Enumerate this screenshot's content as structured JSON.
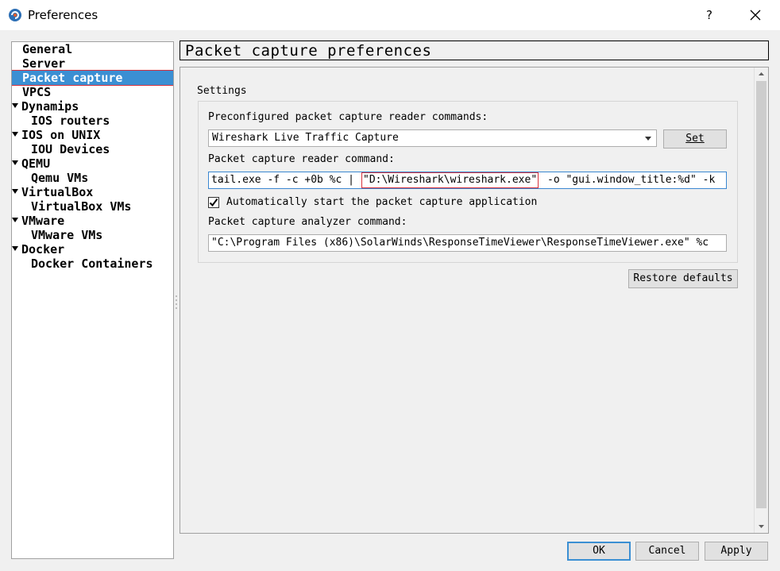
{
  "window": {
    "title": "Preferences",
    "help_label": "?"
  },
  "sidebar": {
    "items": [
      {
        "label": "General",
        "expandable": false,
        "selected": false
      },
      {
        "label": "Server",
        "expandable": false,
        "selected": false
      },
      {
        "label": "Packet capture",
        "expandable": false,
        "selected": true
      },
      {
        "label": "VPCS",
        "expandable": false,
        "selected": false
      },
      {
        "label": "Dynamips",
        "expandable": true,
        "selected": false
      },
      {
        "label": "IOS routers",
        "expandable": false,
        "selected": false
      },
      {
        "label": "IOS on UNIX",
        "expandable": true,
        "selected": false
      },
      {
        "label": "IOU Devices",
        "expandable": false,
        "selected": false
      },
      {
        "label": "QEMU",
        "expandable": true,
        "selected": false
      },
      {
        "label": "Qemu VMs",
        "expandable": false,
        "selected": false
      },
      {
        "label": "VirtualBox",
        "expandable": true,
        "selected": false
      },
      {
        "label": "VirtualBox VMs",
        "expandable": false,
        "selected": false
      },
      {
        "label": "VMware",
        "expandable": true,
        "selected": false
      },
      {
        "label": "VMware VMs",
        "expandable": false,
        "selected": false
      },
      {
        "label": "Docker",
        "expandable": true,
        "selected": false
      },
      {
        "label": "Docker Containers",
        "expandable": false,
        "selected": false
      }
    ]
  },
  "page": {
    "title": "Packet capture preferences",
    "settings_label": "Settings",
    "preconfigured_label": "Preconfigured packet capture reader commands:",
    "preconfigured_value": "Wireshark Live Traffic Capture",
    "set_label": "Set",
    "reader_label": "Packet capture reader command:",
    "reader_part1": "tail.exe -f -c +0b %c |",
    "reader_part2": "\"D:\\Wireshark\\wireshark.exe\"",
    "reader_part3": "-o \"gui.window_title:%d\" -k",
    "autostart_label": "Automatically start the packet capture application",
    "autostart_checked": true,
    "analyzer_label": "Packet capture analyzer command:",
    "analyzer_value": "\"C:\\Program Files (x86)\\SolarWinds\\ResponseTimeViewer\\ResponseTimeViewer.exe\" %c",
    "restore_label": "Restore defaults"
  },
  "footer": {
    "ok_label": "OK",
    "cancel_label": "Cancel",
    "apply_label": "Apply"
  },
  "colors": {
    "selection": "#3b8fd3",
    "highlight_border": "#d9303b",
    "focus_border": "#3a87d1"
  }
}
